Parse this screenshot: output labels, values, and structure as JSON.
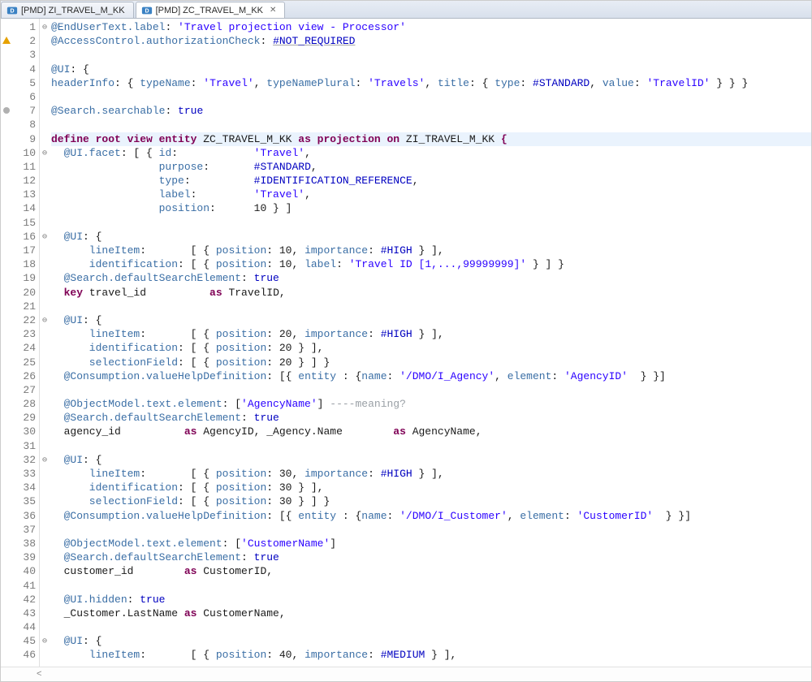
{
  "tabs": [
    {
      "label": "[PMD] ZI_TRAVEL_M_KK",
      "active": false
    },
    {
      "label": "[PMD] ZC_TRAVEL_M_KK",
      "active": true
    }
  ],
  "code": {
    "lines": [
      {
        "n": 1,
        "fold": "⊖",
        "marker": "",
        "segs": [
          {
            "c": "ann",
            "t": "@EndUserText.label"
          },
          {
            "c": "id",
            "t": ": "
          },
          {
            "c": "str",
            "t": "'Travel projection view - Processor'"
          }
        ]
      },
      {
        "n": 2,
        "fold": "",
        "marker": "warn",
        "segs": [
          {
            "c": "ann",
            "t": "@AccessControl.authorizationCheck"
          },
          {
            "c": "id",
            "t": ": "
          },
          {
            "c": "cst ul",
            "t": "#NOT_REQUIRED"
          }
        ]
      },
      {
        "n": 3,
        "fold": "",
        "marker": "",
        "segs": [
          {
            "c": "",
            "t": ""
          }
        ]
      },
      {
        "n": 4,
        "fold": "",
        "marker": "",
        "segs": [
          {
            "c": "ann",
            "t": "@UI"
          },
          {
            "c": "id",
            "t": ": {"
          }
        ]
      },
      {
        "n": 5,
        "fold": "",
        "marker": "",
        "segs": [
          {
            "c": "ann",
            "t": "headerInfo"
          },
          {
            "c": "id",
            "t": ": { "
          },
          {
            "c": "ann",
            "t": "typeName"
          },
          {
            "c": "id",
            "t": ": "
          },
          {
            "c": "str",
            "t": "'Travel'"
          },
          {
            "c": "id",
            "t": ", "
          },
          {
            "c": "ann",
            "t": "typeNamePlural"
          },
          {
            "c": "id",
            "t": ": "
          },
          {
            "c": "str",
            "t": "'Travels'"
          },
          {
            "c": "id",
            "t": ", "
          },
          {
            "c": "ann",
            "t": "title"
          },
          {
            "c": "id",
            "t": ": { "
          },
          {
            "c": "ann",
            "t": "type"
          },
          {
            "c": "id",
            "t": ": "
          },
          {
            "c": "cst",
            "t": "#STANDARD"
          },
          {
            "c": "id",
            "t": ", "
          },
          {
            "c": "ann",
            "t": "value"
          },
          {
            "c": "id",
            "t": ": "
          },
          {
            "c": "str",
            "t": "'TravelID'"
          },
          {
            "c": "id",
            "t": " } } }"
          }
        ]
      },
      {
        "n": 6,
        "fold": "",
        "marker": "",
        "segs": [
          {
            "c": "",
            "t": ""
          }
        ]
      },
      {
        "n": 7,
        "fold": "",
        "marker": "info",
        "segs": [
          {
            "c": "ann",
            "t": "@Search.searchable"
          },
          {
            "c": "id",
            "t": ": "
          },
          {
            "c": "cst",
            "t": "true"
          }
        ]
      },
      {
        "n": 8,
        "fold": "",
        "marker": "",
        "segs": [
          {
            "c": "",
            "t": ""
          }
        ]
      },
      {
        "n": 9,
        "fold": "",
        "marker": "",
        "hl": true,
        "segs": [
          {
            "c": "k",
            "t": "define root view entity "
          },
          {
            "c": "nm",
            "t": "ZC_TRAVEL_M_KK "
          },
          {
            "c": "k",
            "t": "as projection on "
          },
          {
            "c": "nm",
            "t": "ZI_TRAVEL_M_KK "
          },
          {
            "c": "k",
            "t": "{"
          }
        ]
      },
      {
        "n": 10,
        "fold": "⊖",
        "marker": "",
        "segs": [
          {
            "c": "ann",
            "t": "  @UI.facet"
          },
          {
            "c": "id",
            "t": ": [ { "
          },
          {
            "c": "ann",
            "t": "id"
          },
          {
            "c": "id",
            "t": ":            "
          },
          {
            "c": "str",
            "t": "'Travel'"
          },
          {
            "c": "id",
            "t": ","
          }
        ]
      },
      {
        "n": 11,
        "fold": "",
        "marker": "",
        "segs": [
          {
            "c": "id",
            "t": "                 "
          },
          {
            "c": "ann",
            "t": "purpose"
          },
          {
            "c": "id",
            "t": ":       "
          },
          {
            "c": "cst",
            "t": "#STANDARD"
          },
          {
            "c": "id",
            "t": ","
          }
        ]
      },
      {
        "n": 12,
        "fold": "",
        "marker": "",
        "segs": [
          {
            "c": "id",
            "t": "                 "
          },
          {
            "c": "ann",
            "t": "type"
          },
          {
            "c": "id",
            "t": ":          "
          },
          {
            "c": "cst",
            "t": "#IDENTIFICATION_REFERENCE"
          },
          {
            "c": "id",
            "t": ","
          }
        ]
      },
      {
        "n": 13,
        "fold": "",
        "marker": "",
        "segs": [
          {
            "c": "id",
            "t": "                 "
          },
          {
            "c": "ann",
            "t": "label"
          },
          {
            "c": "id",
            "t": ":         "
          },
          {
            "c": "str",
            "t": "'Travel'"
          },
          {
            "c": "id",
            "t": ","
          }
        ]
      },
      {
        "n": 14,
        "fold": "",
        "marker": "",
        "segs": [
          {
            "c": "id",
            "t": "                 "
          },
          {
            "c": "ann",
            "t": "position"
          },
          {
            "c": "id",
            "t": ":      10 } ]"
          }
        ]
      },
      {
        "n": 15,
        "fold": "",
        "marker": "",
        "segs": [
          {
            "c": "",
            "t": ""
          }
        ]
      },
      {
        "n": 16,
        "fold": "⊖",
        "marker": "",
        "segs": [
          {
            "c": "ann",
            "t": "  @UI"
          },
          {
            "c": "id",
            "t": ": {"
          }
        ]
      },
      {
        "n": 17,
        "fold": "",
        "marker": "",
        "segs": [
          {
            "c": "ann",
            "t": "      lineItem"
          },
          {
            "c": "id",
            "t": ":       [ { "
          },
          {
            "c": "ann",
            "t": "position"
          },
          {
            "c": "id",
            "t": ": 10, "
          },
          {
            "c": "ann",
            "t": "importance"
          },
          {
            "c": "id",
            "t": ": "
          },
          {
            "c": "cst",
            "t": "#HIGH"
          },
          {
            "c": "id",
            "t": " } ],"
          }
        ]
      },
      {
        "n": 18,
        "fold": "",
        "marker": "",
        "segs": [
          {
            "c": "ann",
            "t": "      identification"
          },
          {
            "c": "id",
            "t": ": [ { "
          },
          {
            "c": "ann",
            "t": "position"
          },
          {
            "c": "id",
            "t": ": 10, "
          },
          {
            "c": "ann",
            "t": "label"
          },
          {
            "c": "id",
            "t": ": "
          },
          {
            "c": "str",
            "t": "'Travel ID [1,...,99999999]'"
          },
          {
            "c": "id",
            "t": " } ] }"
          }
        ]
      },
      {
        "n": 19,
        "fold": "",
        "marker": "",
        "segs": [
          {
            "c": "ann",
            "t": "  @Search.defaultSearchElement"
          },
          {
            "c": "id",
            "t": ": "
          },
          {
            "c": "cst",
            "t": "true"
          }
        ]
      },
      {
        "n": 20,
        "fold": "",
        "marker": "",
        "segs": [
          {
            "c": "id",
            "t": "  "
          },
          {
            "c": "k",
            "t": "key"
          },
          {
            "c": "id",
            "t": " travel_id          "
          },
          {
            "c": "k",
            "t": "as"
          },
          {
            "c": "id",
            "t": " TravelID,"
          }
        ]
      },
      {
        "n": 21,
        "fold": "",
        "marker": "",
        "segs": [
          {
            "c": "",
            "t": ""
          }
        ]
      },
      {
        "n": 22,
        "fold": "⊖",
        "marker": "",
        "segs": [
          {
            "c": "ann",
            "t": "  @UI"
          },
          {
            "c": "id",
            "t": ": {"
          }
        ]
      },
      {
        "n": 23,
        "fold": "",
        "marker": "",
        "segs": [
          {
            "c": "ann",
            "t": "      lineItem"
          },
          {
            "c": "id",
            "t": ":       [ { "
          },
          {
            "c": "ann",
            "t": "position"
          },
          {
            "c": "id",
            "t": ": 20, "
          },
          {
            "c": "ann",
            "t": "importance"
          },
          {
            "c": "id",
            "t": ": "
          },
          {
            "c": "cst",
            "t": "#HIGH"
          },
          {
            "c": "id",
            "t": " } ],"
          }
        ]
      },
      {
        "n": 24,
        "fold": "",
        "marker": "",
        "segs": [
          {
            "c": "ann",
            "t": "      identification"
          },
          {
            "c": "id",
            "t": ": [ { "
          },
          {
            "c": "ann",
            "t": "position"
          },
          {
            "c": "id",
            "t": ": 20 } ],"
          }
        ]
      },
      {
        "n": 25,
        "fold": "",
        "marker": "",
        "segs": [
          {
            "c": "ann",
            "t": "      selectionField"
          },
          {
            "c": "id",
            "t": ": [ { "
          },
          {
            "c": "ann",
            "t": "position"
          },
          {
            "c": "id",
            "t": ": 20 } ] }"
          }
        ]
      },
      {
        "n": 26,
        "fold": "",
        "marker": "",
        "segs": [
          {
            "c": "ann",
            "t": "  @Consumption.valueHelpDefinition"
          },
          {
            "c": "id",
            "t": ": [{ "
          },
          {
            "c": "ann",
            "t": "entity"
          },
          {
            "c": "id",
            "t": " : {"
          },
          {
            "c": "ann",
            "t": "name"
          },
          {
            "c": "id",
            "t": ": "
          },
          {
            "c": "str",
            "t": "'/DMO/I_Agency'"
          },
          {
            "c": "id",
            "t": ", "
          },
          {
            "c": "ann",
            "t": "element"
          },
          {
            "c": "id",
            "t": ": "
          },
          {
            "c": "str",
            "t": "'AgencyID'"
          },
          {
            "c": "id",
            "t": "  } }]"
          }
        ]
      },
      {
        "n": 27,
        "fold": "",
        "marker": "",
        "segs": [
          {
            "c": "",
            "t": ""
          }
        ]
      },
      {
        "n": 28,
        "fold": "",
        "marker": "",
        "segs": [
          {
            "c": "ann",
            "t": "  @ObjectModel.text.element"
          },
          {
            "c": "id",
            "t": ": ["
          },
          {
            "c": "str",
            "t": "'AgencyName'"
          },
          {
            "c": "id",
            "t": "] "
          },
          {
            "c": "cmt",
            "t": "----meaning?"
          }
        ]
      },
      {
        "n": 29,
        "fold": "",
        "marker": "",
        "segs": [
          {
            "c": "ann",
            "t": "  @Search.defaultSearchElement"
          },
          {
            "c": "id",
            "t": ": "
          },
          {
            "c": "cst",
            "t": "true"
          }
        ]
      },
      {
        "n": 30,
        "fold": "",
        "marker": "",
        "segs": [
          {
            "c": "id",
            "t": "  agency_id          "
          },
          {
            "c": "k",
            "t": "as"
          },
          {
            "c": "id",
            "t": " AgencyID, _Agency.Name        "
          },
          {
            "c": "k",
            "t": "as"
          },
          {
            "c": "id",
            "t": " AgencyName,"
          }
        ]
      },
      {
        "n": 31,
        "fold": "",
        "marker": "",
        "segs": [
          {
            "c": "",
            "t": ""
          }
        ]
      },
      {
        "n": 32,
        "fold": "⊖",
        "marker": "",
        "segs": [
          {
            "c": "ann",
            "t": "  @UI"
          },
          {
            "c": "id",
            "t": ": {"
          }
        ]
      },
      {
        "n": 33,
        "fold": "",
        "marker": "",
        "segs": [
          {
            "c": "ann",
            "t": "      lineItem"
          },
          {
            "c": "id",
            "t": ":       [ { "
          },
          {
            "c": "ann",
            "t": "position"
          },
          {
            "c": "id",
            "t": ": 30, "
          },
          {
            "c": "ann",
            "t": "importance"
          },
          {
            "c": "id",
            "t": ": "
          },
          {
            "c": "cst",
            "t": "#HIGH"
          },
          {
            "c": "id",
            "t": " } ],"
          }
        ]
      },
      {
        "n": 34,
        "fold": "",
        "marker": "",
        "segs": [
          {
            "c": "ann",
            "t": "      identification"
          },
          {
            "c": "id",
            "t": ": [ { "
          },
          {
            "c": "ann",
            "t": "position"
          },
          {
            "c": "id",
            "t": ": 30 } ],"
          }
        ]
      },
      {
        "n": 35,
        "fold": "",
        "marker": "",
        "segs": [
          {
            "c": "ann",
            "t": "      selectionField"
          },
          {
            "c": "id",
            "t": ": [ { "
          },
          {
            "c": "ann",
            "t": "position"
          },
          {
            "c": "id",
            "t": ": 30 } ] }"
          }
        ]
      },
      {
        "n": 36,
        "fold": "",
        "marker": "",
        "segs": [
          {
            "c": "ann",
            "t": "  @Consumption.valueHelpDefinition"
          },
          {
            "c": "id",
            "t": ": [{ "
          },
          {
            "c": "ann",
            "t": "entity"
          },
          {
            "c": "id",
            "t": " : {"
          },
          {
            "c": "ann",
            "t": "name"
          },
          {
            "c": "id",
            "t": ": "
          },
          {
            "c": "str",
            "t": "'/DMO/I_Customer'"
          },
          {
            "c": "id",
            "t": ", "
          },
          {
            "c": "ann",
            "t": "element"
          },
          {
            "c": "id",
            "t": ": "
          },
          {
            "c": "str",
            "t": "'CustomerID'"
          },
          {
            "c": "id",
            "t": "  } }]"
          }
        ]
      },
      {
        "n": 37,
        "fold": "",
        "marker": "",
        "segs": [
          {
            "c": "",
            "t": ""
          }
        ]
      },
      {
        "n": 38,
        "fold": "",
        "marker": "",
        "segs": [
          {
            "c": "ann",
            "t": "  @ObjectModel.text.element"
          },
          {
            "c": "id",
            "t": ": ["
          },
          {
            "c": "str",
            "t": "'CustomerName'"
          },
          {
            "c": "id",
            "t": "]"
          }
        ]
      },
      {
        "n": 39,
        "fold": "",
        "marker": "",
        "segs": [
          {
            "c": "ann",
            "t": "  @Search.defaultSearchElement"
          },
          {
            "c": "id",
            "t": ": "
          },
          {
            "c": "cst",
            "t": "true"
          }
        ]
      },
      {
        "n": 40,
        "fold": "",
        "marker": "",
        "segs": [
          {
            "c": "id",
            "t": "  customer_id        "
          },
          {
            "c": "k",
            "t": "as"
          },
          {
            "c": "id",
            "t": " CustomerID,"
          }
        ]
      },
      {
        "n": 41,
        "fold": "",
        "marker": "",
        "segs": [
          {
            "c": "",
            "t": ""
          }
        ]
      },
      {
        "n": 42,
        "fold": "",
        "marker": "",
        "segs": [
          {
            "c": "ann",
            "t": "  @UI.hidden"
          },
          {
            "c": "id",
            "t": ": "
          },
          {
            "c": "cst",
            "t": "true"
          }
        ]
      },
      {
        "n": 43,
        "fold": "",
        "marker": "",
        "segs": [
          {
            "c": "id",
            "t": "  _Customer.LastName "
          },
          {
            "c": "k",
            "t": "as"
          },
          {
            "c": "id",
            "t": " CustomerName,"
          }
        ]
      },
      {
        "n": 44,
        "fold": "",
        "marker": "",
        "segs": [
          {
            "c": "",
            "t": ""
          }
        ]
      },
      {
        "n": 45,
        "fold": "⊖",
        "marker": "",
        "segs": [
          {
            "c": "ann",
            "t": "  @UI"
          },
          {
            "c": "id",
            "t": ": {"
          }
        ]
      },
      {
        "n": 46,
        "fold": "",
        "marker": "",
        "segs": [
          {
            "c": "ann",
            "t": "      lineItem"
          },
          {
            "c": "id",
            "t": ":       [ { "
          },
          {
            "c": "ann",
            "t": "position"
          },
          {
            "c": "id",
            "t": ": 40, "
          },
          {
            "c": "ann",
            "t": "importance"
          },
          {
            "c": "id",
            "t": ": "
          },
          {
            "c": "cst",
            "t": "#MEDIUM"
          },
          {
            "c": "id",
            "t": " } ],"
          }
        ]
      }
    ]
  }
}
